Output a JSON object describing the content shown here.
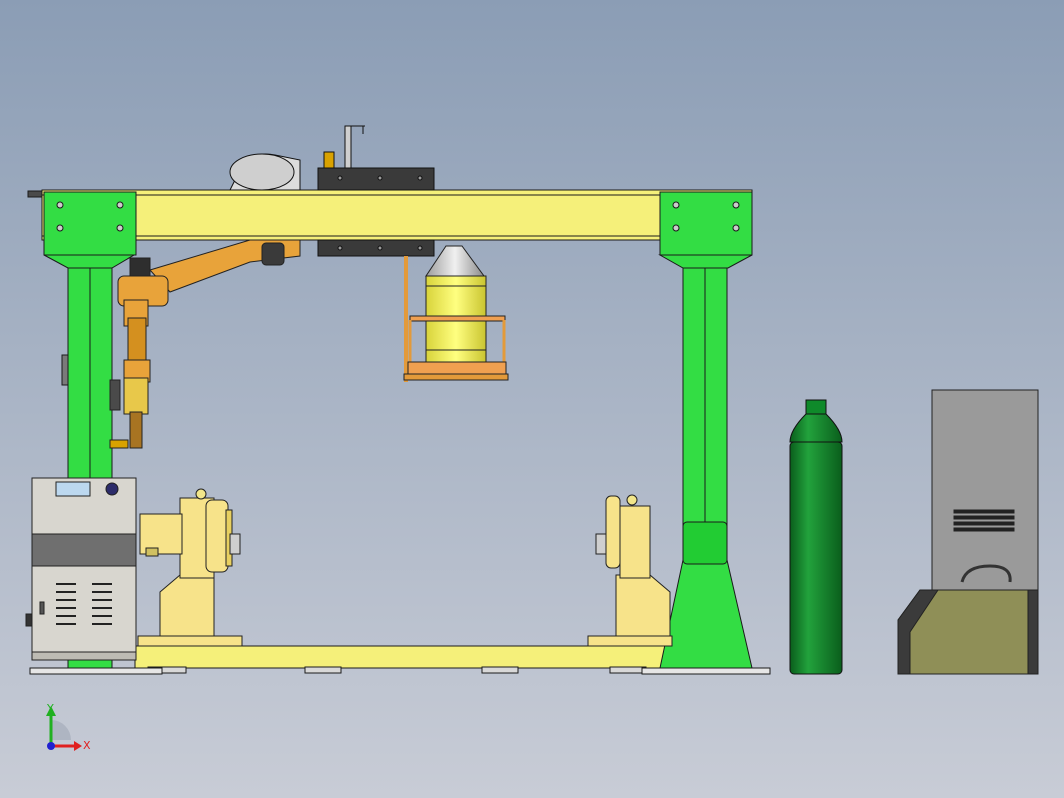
{
  "colors": {
    "background_top": "#8b9db5",
    "background_bottom": "#c8ccd6",
    "frame_yellow": "#f5f07a",
    "frame_green": "#33dd44",
    "positioner_yellow": "#f7e38a",
    "robot_orange": "#e8a33a",
    "cylinder_green": "#0f8a2a",
    "welder_grey": "#d8d6cf",
    "welder_band": "#6f6f6f",
    "chiller_top": "#9a9a9a",
    "chiller_base": "#8f8f57",
    "plate_dark": "#3b3b3b"
  },
  "triad": {
    "x_label": "X",
    "y_label": "Y",
    "x_color": "#e02020",
    "y_color": "#20b020",
    "z_color": "#2020d0"
  }
}
